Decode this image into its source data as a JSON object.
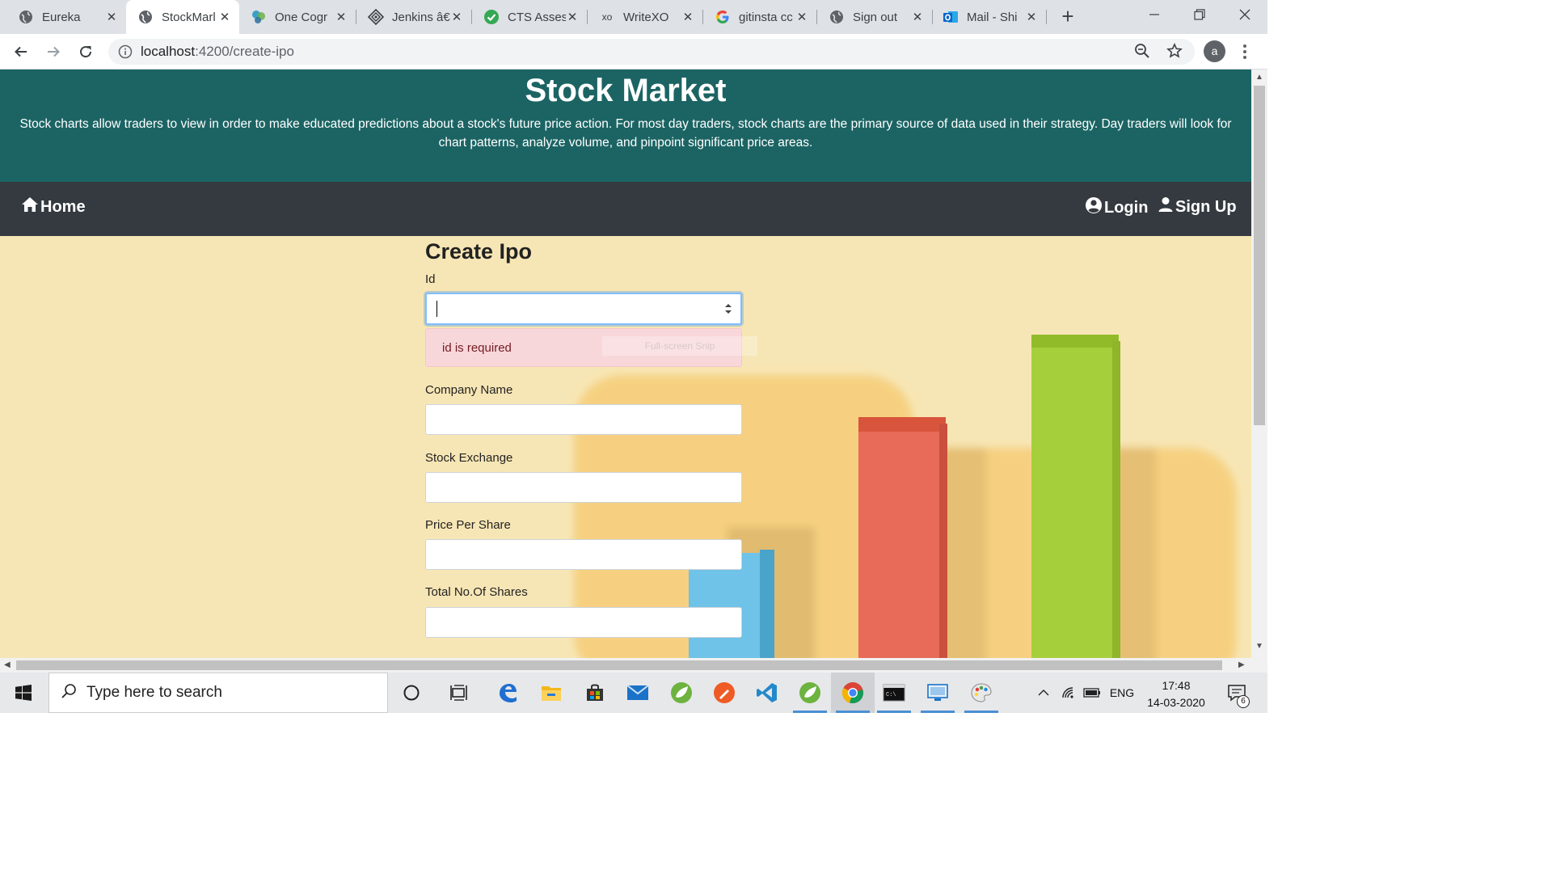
{
  "browser": {
    "tabs": [
      {
        "label": "Eureka",
        "icon": "globe-icon"
      },
      {
        "label": "StockMarl",
        "icon": "globe-icon",
        "active": true
      },
      {
        "label": "One Cogr",
        "icon": "onecognizant-icon"
      },
      {
        "label": "Jenkins â€",
        "icon": "jenkins-icon"
      },
      {
        "label": "CTS Asses",
        "icon": "checkmark-icon"
      },
      {
        "label": "WriteXO",
        "icon": "xo-icon",
        "icon_text": "xo"
      },
      {
        "label": "gitinsta cc",
        "icon": "google-icon"
      },
      {
        "label": "Sign out",
        "icon": "globe-icon"
      },
      {
        "label": "Mail - Shi",
        "icon": "outlook-icon"
      }
    ],
    "close_glyph": "✕",
    "new_tab_glyph": "+",
    "url_host": "localhost",
    "url_path": ":4200/create-ipo",
    "profile_initial": "a"
  },
  "page": {
    "title": "Stock Market",
    "description": "Stock charts allow traders to view in order to make educated predictions about a stock's future price action. For most day traders, stock charts are the primary source of data used in their strategy. Day traders will look for chart patterns, analyze volume, and pinpoint significant price areas.",
    "nav": {
      "home": "Home",
      "login": "Login",
      "signup": "Sign Up"
    },
    "colors": {
      "hero_bg": "#1c6464",
      "navbar_bg": "#343a40",
      "page_bg": "#f7e6b5",
      "alert_bg": "#f8d7da",
      "alert_text": "#721c24"
    }
  },
  "form": {
    "heading": "Create Ipo",
    "fields": [
      {
        "label": "Id",
        "value": ""
      },
      {
        "label": "Company Name",
        "value": ""
      },
      {
        "label": "Stock Exchange",
        "value": ""
      },
      {
        "label": "Price Per Share",
        "value": ""
      },
      {
        "label": "Total No.Of Shares",
        "value": ""
      }
    ],
    "id_error": "id is required",
    "overlay_hint": "Full-screen Snip"
  },
  "taskbar": {
    "search_placeholder": "Type here to search",
    "apps": [
      "cortana-icon",
      "task-view-icon",
      "edge-icon",
      "file-explorer-icon",
      "store-icon",
      "mail-icon",
      "spring-tool-suite-icon",
      "postman-icon",
      "vscode-icon",
      "spring-boot-icon",
      "chrome-icon",
      "cmd-icon",
      "remote-desktop-icon",
      "paint-icon"
    ],
    "language": "ENG",
    "time": "17:48",
    "date": "14-03-2020",
    "notification_count": "6"
  }
}
